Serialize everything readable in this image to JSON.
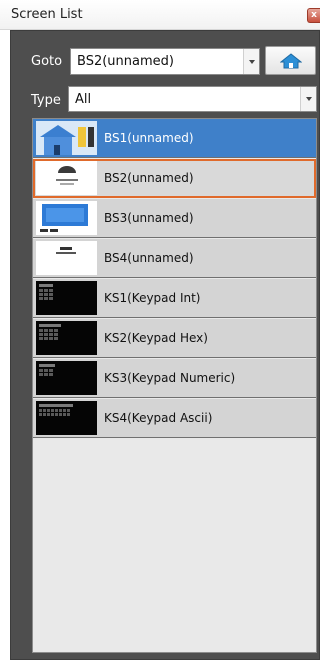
{
  "window": {
    "title": "Screen List",
    "close_icon": "close-icon"
  },
  "goto": {
    "label": "Goto",
    "value": "BS2(unnamed)"
  },
  "type": {
    "label": "Type",
    "value": "All"
  },
  "home_button": {
    "icon": "home-icon"
  },
  "screens": [
    {
      "label": "BS1(unnamed)",
      "selected": true
    },
    {
      "label": "BS2(unnamed)",
      "focused": true
    },
    {
      "label": "BS3(unnamed)"
    },
    {
      "label": "BS4(unnamed)"
    },
    {
      "label": "KS1(Keypad Int)"
    },
    {
      "label": "KS2(Keypad Hex)"
    },
    {
      "label": "KS3(Keypad Numeric)"
    },
    {
      "label": "KS4(Keypad Ascii)"
    }
  ],
  "colors": {
    "selection": "#3f80c9",
    "focus_border": "#e06a2b",
    "panel": "#4e4e4e"
  }
}
